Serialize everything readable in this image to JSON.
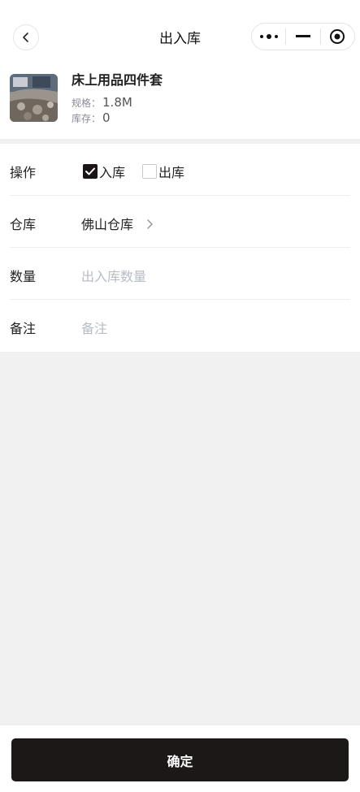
{
  "navbar": {
    "title": "出入库"
  },
  "product": {
    "name": "床上用品四件套",
    "spec_label": "规格：",
    "spec_value": "1.8M",
    "stock_label": "库存：",
    "stock_value": "0"
  },
  "form": {
    "operation": {
      "label": "操作",
      "options": [
        {
          "label": "入库",
          "checked": true
        },
        {
          "label": "出库",
          "checked": false
        }
      ]
    },
    "warehouse": {
      "label": "仓库",
      "value": "佛山仓库"
    },
    "quantity": {
      "label": "数量",
      "placeholder": "出入库数量"
    },
    "remark": {
      "label": "备注",
      "placeholder": "备注"
    }
  },
  "footer": {
    "confirm_label": "确定"
  }
}
